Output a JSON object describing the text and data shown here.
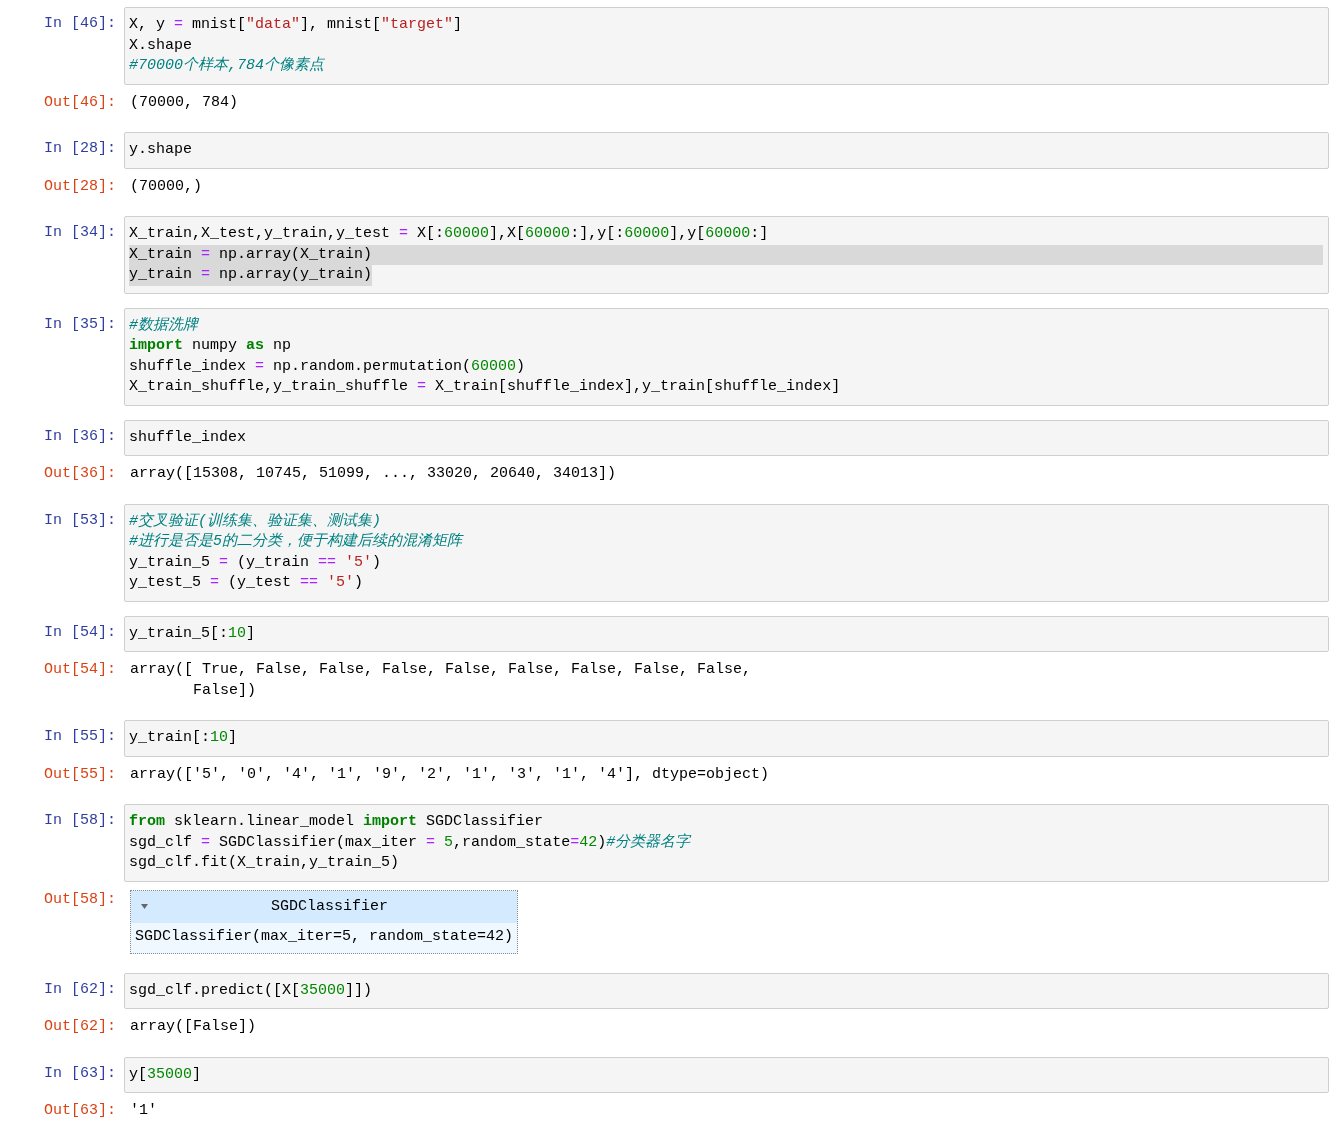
{
  "cells": [
    {
      "input_prompt": "In [46]:",
      "code": [
        {
          "tokens": [
            {
              "t": "X, y ",
              "kind": "plain"
            },
            {
              "t": "=",
              "kind": "op"
            },
            {
              "t": " mnist[",
              "kind": "plain"
            },
            {
              "t": "\"data\"",
              "kind": "str"
            },
            {
              "t": "], mnist[",
              "kind": "plain"
            },
            {
              "t": "\"target\"",
              "kind": "str"
            },
            {
              "t": "]",
              "kind": "plain"
            }
          ]
        },
        {
          "tokens": [
            {
              "t": "X.shape",
              "kind": "plain"
            }
          ]
        },
        {
          "tokens": [
            {
              "t": "#70000个样本,784个像素点",
              "kind": "comment"
            }
          ]
        }
      ],
      "output": {
        "prompt": "Out[46]:",
        "kind": "text",
        "lines": [
          "(70000, 784)"
        ]
      }
    },
    {
      "input_prompt": "In [28]:",
      "code": [
        {
          "tokens": [
            {
              "t": "y.shape",
              "kind": "plain"
            }
          ]
        }
      ],
      "output": {
        "prompt": "Out[28]:",
        "kind": "text",
        "lines": [
          "(70000,)"
        ]
      }
    },
    {
      "input_prompt": "In [34]:",
      "code": [
        {
          "selected": false,
          "tokens": [
            {
              "t": "X_train,X_test,y_train,y_test ",
              "kind": "plain"
            },
            {
              "t": "=",
              "kind": "op"
            },
            {
              "t": " X[:",
              "kind": "plain"
            },
            {
              "t": "60000",
              "kind": "num"
            },
            {
              "t": "],X[",
              "kind": "plain"
            },
            {
              "t": "60000",
              "kind": "num"
            },
            {
              "t": ":],y[:",
              "kind": "plain"
            },
            {
              "t": "60000",
              "kind": "num"
            },
            {
              "t": "],y[",
              "kind": "plain"
            },
            {
              "t": "60000",
              "kind": "num"
            },
            {
              "t": ":]",
              "kind": "plain"
            }
          ]
        },
        {
          "selected": true,
          "tokens": [
            {
              "t": "X_train ",
              "kind": "plain"
            },
            {
              "t": "=",
              "kind": "op"
            },
            {
              "t": " np.array(X_train)",
              "kind": "plain"
            }
          ]
        },
        {
          "selected": true,
          "tokens": [
            {
              "t": "y_train ",
              "kind": "plain"
            },
            {
              "t": "=",
              "kind": "op"
            },
            {
              "t": " np.array(y_train)",
              "kind": "plain"
            }
          ]
        }
      ]
    },
    {
      "input_prompt": "In [35]:",
      "code": [
        {
          "tokens": [
            {
              "t": "#数据洗牌",
              "kind": "comment"
            }
          ]
        },
        {
          "tokens": [
            {
              "t": "import",
              "kind": "kw"
            },
            {
              "t": " numpy ",
              "kind": "plain"
            },
            {
              "t": "as",
              "kind": "kw"
            },
            {
              "t": " np",
              "kind": "plain"
            }
          ]
        },
        {
          "tokens": [
            {
              "t": "shuffle_index ",
              "kind": "plain"
            },
            {
              "t": "=",
              "kind": "op"
            },
            {
              "t": " np.random.permutation(",
              "kind": "plain"
            },
            {
              "t": "60000",
              "kind": "num"
            },
            {
              "t": ")",
              "kind": "plain"
            }
          ]
        },
        {
          "tokens": [
            {
              "t": "X_train_shuffle,y_train_shuffle ",
              "kind": "plain"
            },
            {
              "t": "=",
              "kind": "op"
            },
            {
              "t": " X_train[shuffle_index],y_train[shuffle_index]",
              "kind": "plain"
            }
          ]
        }
      ]
    },
    {
      "input_prompt": "In [36]:",
      "code": [
        {
          "tokens": [
            {
              "t": "shuffle_index",
              "kind": "plain"
            }
          ]
        }
      ],
      "output": {
        "prompt": "Out[36]:",
        "kind": "text",
        "lines": [
          "array([15308, 10745, 51099, ..., 33020, 20640, 34013])"
        ]
      }
    },
    {
      "input_prompt": "In [53]:",
      "code": [
        {
          "tokens": [
            {
              "t": "#交叉验证(训练集、验证集、测试集)",
              "kind": "comment"
            }
          ]
        },
        {
          "tokens": [
            {
              "t": "#进行是否是5的二分类，便于构建后续的混淆矩阵",
              "kind": "comment"
            }
          ]
        },
        {
          "tokens": [
            {
              "t": "y_train_5 ",
              "kind": "plain"
            },
            {
              "t": "=",
              "kind": "op"
            },
            {
              "t": " (y_train ",
              "kind": "plain"
            },
            {
              "t": "==",
              "kind": "op"
            },
            {
              "t": " '5'",
              "kind": "str"
            },
            {
              "t": ")",
              "kind": "plain"
            }
          ]
        },
        {
          "tokens": [
            {
              "t": "y_test_5 ",
              "kind": "plain"
            },
            {
              "t": "=",
              "kind": "op"
            },
            {
              "t": " (y_test ",
              "kind": "plain"
            },
            {
              "t": "==",
              "kind": "op"
            },
            {
              "t": " '5'",
              "kind": "str"
            },
            {
              "t": ")",
              "kind": "plain"
            }
          ]
        }
      ]
    },
    {
      "input_prompt": "In [54]:",
      "code": [
        {
          "tokens": [
            {
              "t": "y_train_5[:",
              "kind": "plain"
            },
            {
              "t": "10",
              "kind": "num"
            },
            {
              "t": "]",
              "kind": "plain"
            }
          ]
        }
      ],
      "output": {
        "prompt": "Out[54]:",
        "kind": "text",
        "lines": [
          "array([ True, False, False, False, False, False, False, False, False,",
          "       False])"
        ]
      }
    },
    {
      "input_prompt": "In [55]:",
      "code": [
        {
          "tokens": [
            {
              "t": "y_train[:",
              "kind": "plain"
            },
            {
              "t": "10",
              "kind": "num"
            },
            {
              "t": "]",
              "kind": "plain"
            }
          ]
        }
      ],
      "output": {
        "prompt": "Out[55]:",
        "kind": "text",
        "lines": [
          "array(['5', '0', '4', '1', '9', '2', '1', '3', '1', '4'], dtype=object)"
        ]
      }
    },
    {
      "input_prompt": "In [58]:",
      "code": [
        {
          "tokens": [
            {
              "t": "from",
              "kind": "kw"
            },
            {
              "t": " sklearn.linear_model ",
              "kind": "plain"
            },
            {
              "t": "import",
              "kind": "kw"
            },
            {
              "t": " SGDClassifier",
              "kind": "plain"
            }
          ]
        },
        {
          "tokens": [
            {
              "t": "sgd_clf ",
              "kind": "plain"
            },
            {
              "t": "=",
              "kind": "op"
            },
            {
              "t": " SGDClassifier(max_iter ",
              "kind": "plain"
            },
            {
              "t": "=",
              "kind": "op"
            },
            {
              "t": " 5",
              "kind": "num"
            },
            {
              "t": ",random_state",
              "kind": "plain"
            },
            {
              "t": "=",
              "kind": "op"
            },
            {
              "t": "42",
              "kind": "num"
            },
            {
              "t": ")",
              "kind": "plain"
            },
            {
              "t": "#分类器名字",
              "kind": "comment"
            }
          ]
        },
        {
          "tokens": [
            {
              "t": "sgd_clf.fit(X_train,y_train_5)",
              "kind": "plain"
            }
          ]
        }
      ],
      "output": {
        "prompt": "Out[58]:",
        "kind": "estimator",
        "title": "SGDClassifier",
        "lines": [
          "SGDClassifier(max_iter=5, random_state=42)"
        ]
      }
    },
    {
      "input_prompt": "In [62]:",
      "code": [
        {
          "tokens": [
            {
              "t": "sgd_clf.predict([X[",
              "kind": "plain"
            },
            {
              "t": "35000",
              "kind": "num"
            },
            {
              "t": "]])",
              "kind": "plain"
            }
          ]
        }
      ],
      "output": {
        "prompt": "Out[62]:",
        "kind": "text",
        "lines": [
          "array([False])"
        ]
      }
    },
    {
      "input_prompt": "In [63]:",
      "code": [
        {
          "tokens": [
            {
              "t": "y[",
              "kind": "plain"
            },
            {
              "t": "35000",
              "kind": "num"
            },
            {
              "t": "]",
              "kind": "plain"
            }
          ]
        }
      ],
      "output": {
        "prompt": "Out[63]:",
        "kind": "text",
        "lines": [
          "'1'"
        ]
      }
    }
  ]
}
